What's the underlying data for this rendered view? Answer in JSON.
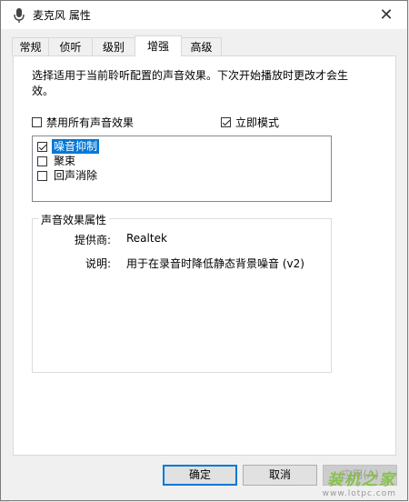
{
  "window": {
    "title": "麦克风 属性",
    "close_symbol": "✕"
  },
  "tabs": [
    {
      "label": "常规"
    },
    {
      "label": "侦听"
    },
    {
      "label": "级别"
    },
    {
      "label": "增强"
    },
    {
      "label": "高级"
    }
  ],
  "active_tab": "增强",
  "panel": {
    "description": "选择适用于当前聆听配置的声音效果。下次开始播放时更改才会生效。",
    "disable_all": {
      "label": "禁用所有声音效果",
      "checked": false
    },
    "immediate_mode": {
      "label": "立即模式",
      "checked": true
    },
    "effects": [
      {
        "label": "噪音抑制",
        "checked": true,
        "selected": true
      },
      {
        "label": "聚束",
        "checked": false,
        "selected": false
      },
      {
        "label": "回声消除",
        "checked": false,
        "selected": false
      }
    ],
    "properties": {
      "title": "声音效果属性",
      "provider_label": "提供商:",
      "provider_value": "Realtek",
      "desc_label": "说明:",
      "desc_value": "用于在录音时降低静态背景噪音 (v2)"
    }
  },
  "buttons": {
    "ok": "确定",
    "cancel": "取消",
    "apply": "应用(A)"
  },
  "watermark": {
    "text": "装机之家",
    "url": "www.lotpc.com"
  },
  "icons": {
    "title_icon": "microphone-icon",
    "close": "close-icon"
  }
}
